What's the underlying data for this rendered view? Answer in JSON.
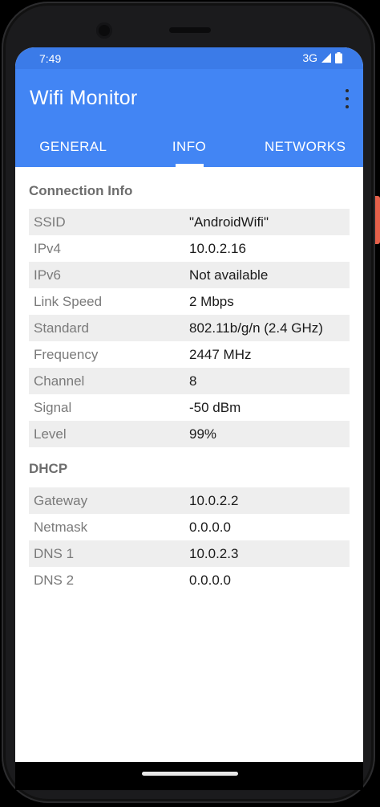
{
  "status_bar": {
    "time": "7:49",
    "network": "3G",
    "icons": [
      "signal-icon",
      "battery-icon"
    ]
  },
  "app_bar": {
    "title": "Wifi Monitor",
    "menu_icon": "overflow-menu-icon"
  },
  "tabs": [
    {
      "label": "GENERAL",
      "selected": false
    },
    {
      "label": "INFO",
      "selected": true
    },
    {
      "label": "NETWORKS",
      "selected": false
    }
  ],
  "connection_info": {
    "title": "Connection Info",
    "rows": [
      {
        "key": "SSID",
        "value": "\"AndroidWifi\""
      },
      {
        "key": "IPv4",
        "value": "10.0.2.16"
      },
      {
        "key": "IPv6",
        "value": "Not available"
      },
      {
        "key": "Link Speed",
        "value": "2 Mbps"
      },
      {
        "key": "Standard",
        "value": "802.11b/g/n (2.4 GHz)"
      },
      {
        "key": "Frequency",
        "value": "2447 MHz"
      },
      {
        "key": "Channel",
        "value": "8"
      },
      {
        "key": "Signal",
        "value": "-50 dBm"
      },
      {
        "key": "Level",
        "value": "99%"
      }
    ]
  },
  "dhcp": {
    "title": "DHCP",
    "rows": [
      {
        "key": "Gateway",
        "value": "10.0.2.2"
      },
      {
        "key": "Netmask",
        "value": "0.0.0.0"
      },
      {
        "key": "DNS 1",
        "value": "10.0.2.3"
      },
      {
        "key": "DNS 2",
        "value": "0.0.0.0"
      }
    ]
  },
  "colors": {
    "status_bar": "#3b7be8",
    "app_bar": "#4285f4",
    "row_stripe": "#eeeeee",
    "key_text": "#7a7a7a",
    "section_title": "#6d6d6d"
  }
}
